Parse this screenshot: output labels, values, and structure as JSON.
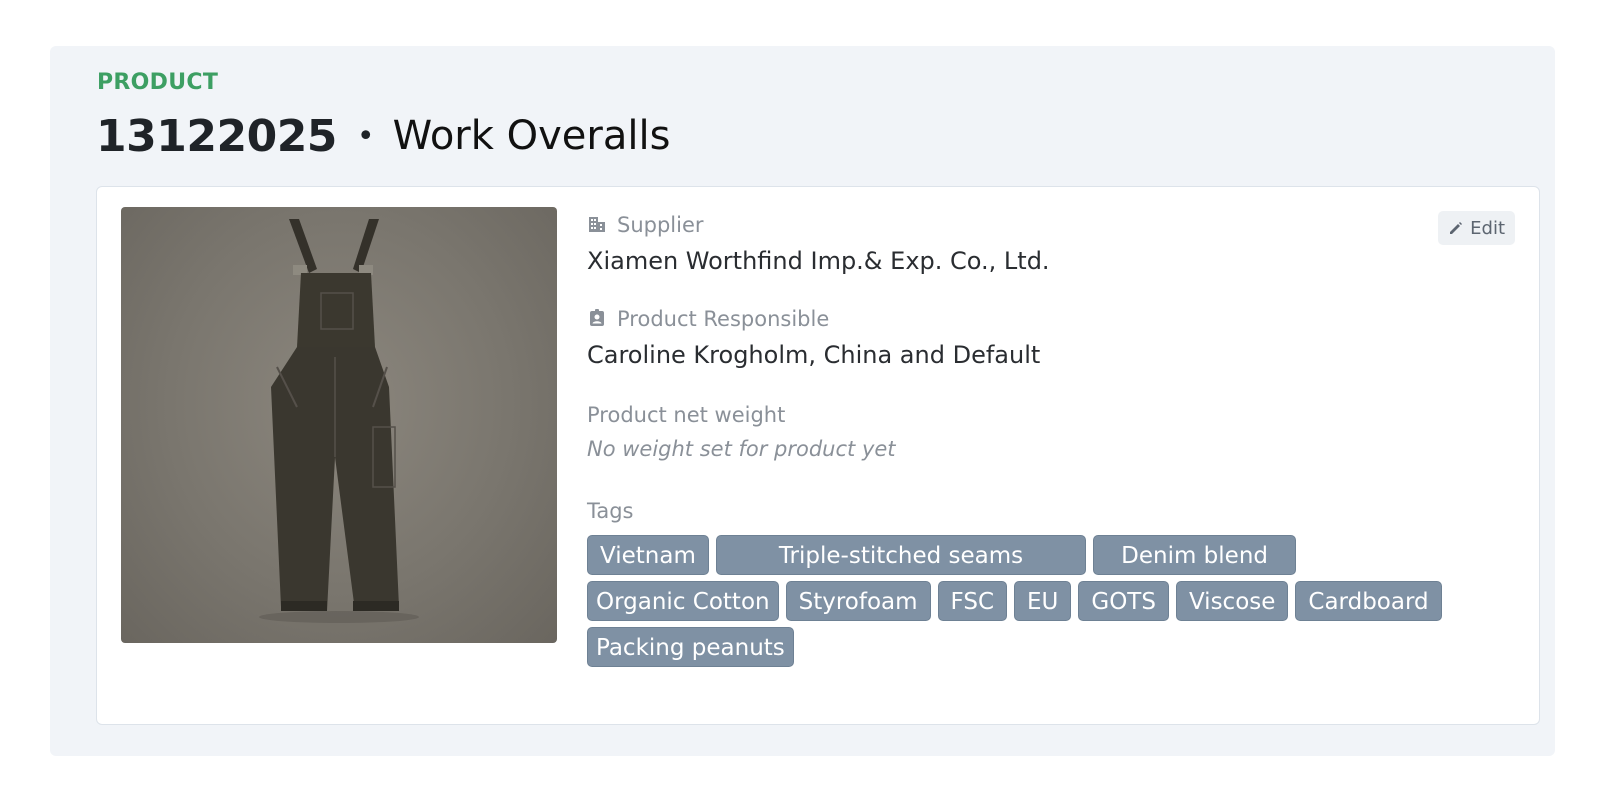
{
  "header": {
    "kicker": "PRODUCT",
    "product_number": "13122025",
    "separator": "•",
    "product_name": "Work Overalls"
  },
  "card": {
    "edit_label": "Edit",
    "supplier": {
      "label": "Supplier",
      "icon": "building-icon",
      "value": "Xiamen Worthfind Imp.& Exp. Co., Ltd."
    },
    "responsible": {
      "label": "Product Responsible",
      "icon": "id-badge-icon",
      "value": "Caroline Krogholm, China and Default"
    },
    "weight": {
      "label": "Product net weight",
      "empty_text": "No weight set for product yet"
    },
    "tags": {
      "label": "Tags",
      "items": [
        "Vietnam",
        "Triple-stitched seams",
        "Denim blend",
        "Organic Cotton",
        "Styrofoam",
        "FSC",
        "EU",
        "GOTS",
        "Viscose",
        "Cardboard",
        "Packing peanuts"
      ]
    }
  },
  "colors": {
    "kicker": "#3d9f63",
    "tag_bg": "#7f91a4",
    "panel_bg": "#f1f4f8"
  }
}
